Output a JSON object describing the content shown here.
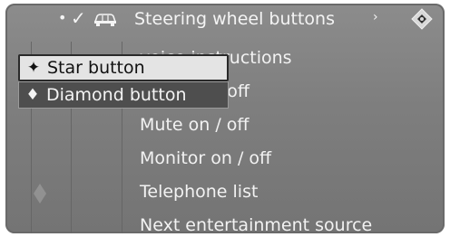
{
  "header": {
    "dot_glyph": "•",
    "check_glyph": "✓",
    "car_icon": "car-settings-icon",
    "title": "Steering wheel buttons",
    "arrow_glyph": "›",
    "controller_icon": "diamond-controller-icon"
  },
  "menu": {
    "items": [
      {
        "label": "voice instructions"
      },
      {
        "label": "ation on / off"
      },
      {
        "label": "Mute on / off"
      },
      {
        "label": "Monitor on / off"
      },
      {
        "label": "Telephone list"
      },
      {
        "label": "Next entertainment source"
      }
    ]
  },
  "popup": {
    "options": [
      {
        "icon_glyph": "✦",
        "label": "Star button",
        "selected": true
      },
      {
        "icon_glyph": "♦",
        "label": "Diamond button",
        "selected": false
      }
    ]
  },
  "colors": {
    "screen_bg": "#808080",
    "text": "#f2f2f2",
    "popup_selected_bg": "#e4e4e4",
    "popup_normal_bg": "#4e4e4e"
  }
}
